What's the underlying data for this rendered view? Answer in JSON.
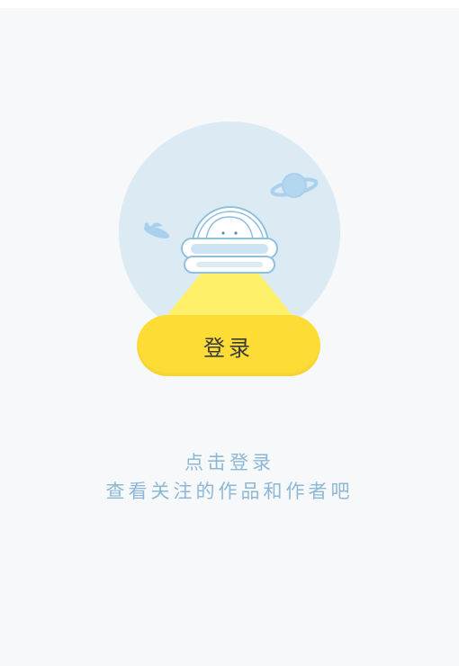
{
  "login_prompt": {
    "button_label": "登录",
    "hint_line1": "点击登录",
    "hint_line2": "查看关注的作品和作者吧"
  },
  "illustration": {
    "icon_names": [
      "planet-icon",
      "ufo-icon",
      "astronaut-icon",
      "light-beam-icon"
    ],
    "colors": {
      "circle": "#dceaf4",
      "ufo_line": "#8fc0e0",
      "beam": "#fff06a",
      "button": "#fddc35",
      "hint_text": "#8cb8d6",
      "background": "#f6f8fa"
    }
  }
}
